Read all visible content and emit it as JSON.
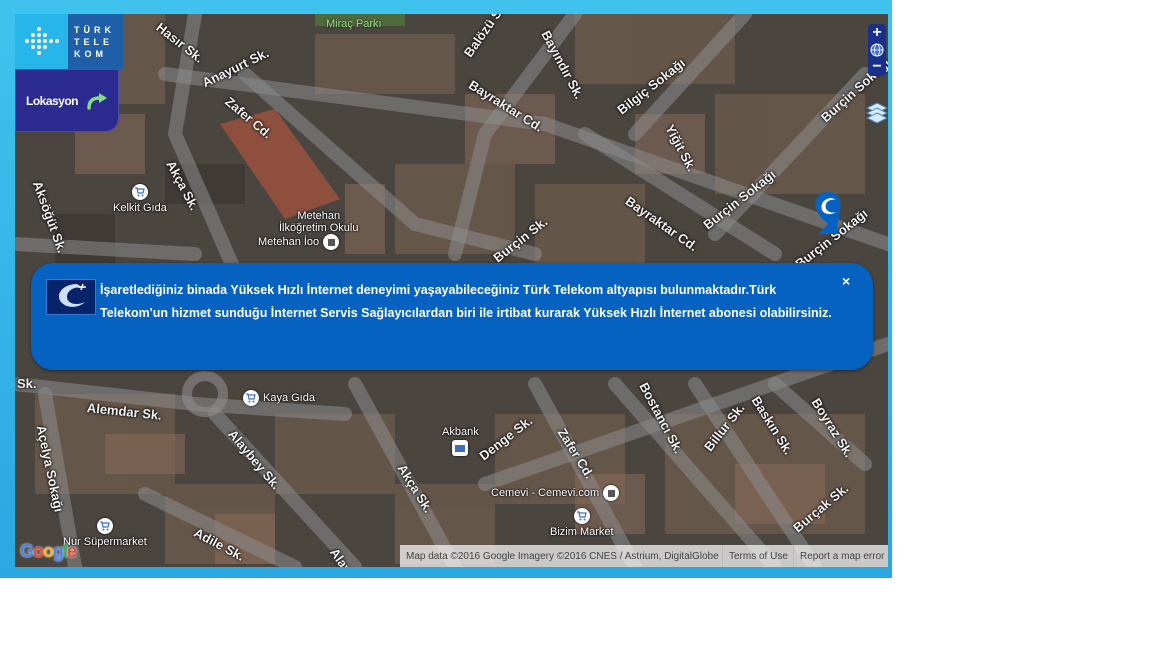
{
  "logo": {
    "lines": [
      "TÜRK",
      "TELE",
      "KOM"
    ]
  },
  "lokasyon": {
    "label": "Lokasyon"
  },
  "map": {
    "streets": [
      "Hasır Sk.",
      "Anayurt Sk.",
      "Zafer Cd.",
      "Akça Sk.",
      "Aksöğüt Sk.",
      "Balözü Sk.",
      "Bayındır Sk.",
      "Bayraktar Cd.",
      "Bilgiç Sokağı",
      "Yiğit Sk.",
      "Burçin Sokağı",
      "Bayraktar Cd.",
      "Burçin Sokağı",
      "Burçin Sk.",
      "Burçin Sokağı",
      "Alemdar Sk.",
      "Açelya Sokağı",
      "Alaybey Sk.",
      "Akça Sk.",
      "Denge Sk.",
      "Zafer Cd.",
      "Bostancı Sk.",
      "Billur Sk.",
      "Baskın Sk.",
      "Boyraz Sk.",
      "Adile Sk.",
      "Burçak Sk.",
      "Alayb",
      "Sk."
    ],
    "park": "Miraç Parkı",
    "pois": {
      "kelkit": "Kelkit Gıda",
      "okul": "Metehan\nİlköğretim Okulu",
      "metehan": "Metehan İoo",
      "kaya": "Kaya Gıda",
      "akbank": "Akbank",
      "cemevi": "Cemevi - Cemevi.com",
      "bizim": "Bizim Market",
      "nur": "Nur Süpermarket"
    }
  },
  "controls": {
    "zoom_in": "+",
    "zoom_out": "−"
  },
  "popup": {
    "message": "İşaretlediğiniz binada Yüksek Hızlı İnternet deneyimi yaşayabileceğiniz Türk Telekom altyapısı bulunmaktadır.Türk Telekom'un hizmet sunduğu İnternet Servis Sağlayıcılardan biri ile irtibat kurarak Yüksek Hızlı İnternet abonesi olabilirsiniz.",
    "close": "×"
  },
  "attribution": {
    "mapdata": "Map data ©2016 Google Imagery ©2016 CNES / Astrium, DigitalGlobe",
    "terms": "Terms of Use",
    "report": "Report a map error",
    "google": "Google"
  },
  "colors": {
    "accent": "#0562c0",
    "frame": "#2aa8e2",
    "lokasyon": "#2a2a8f"
  }
}
